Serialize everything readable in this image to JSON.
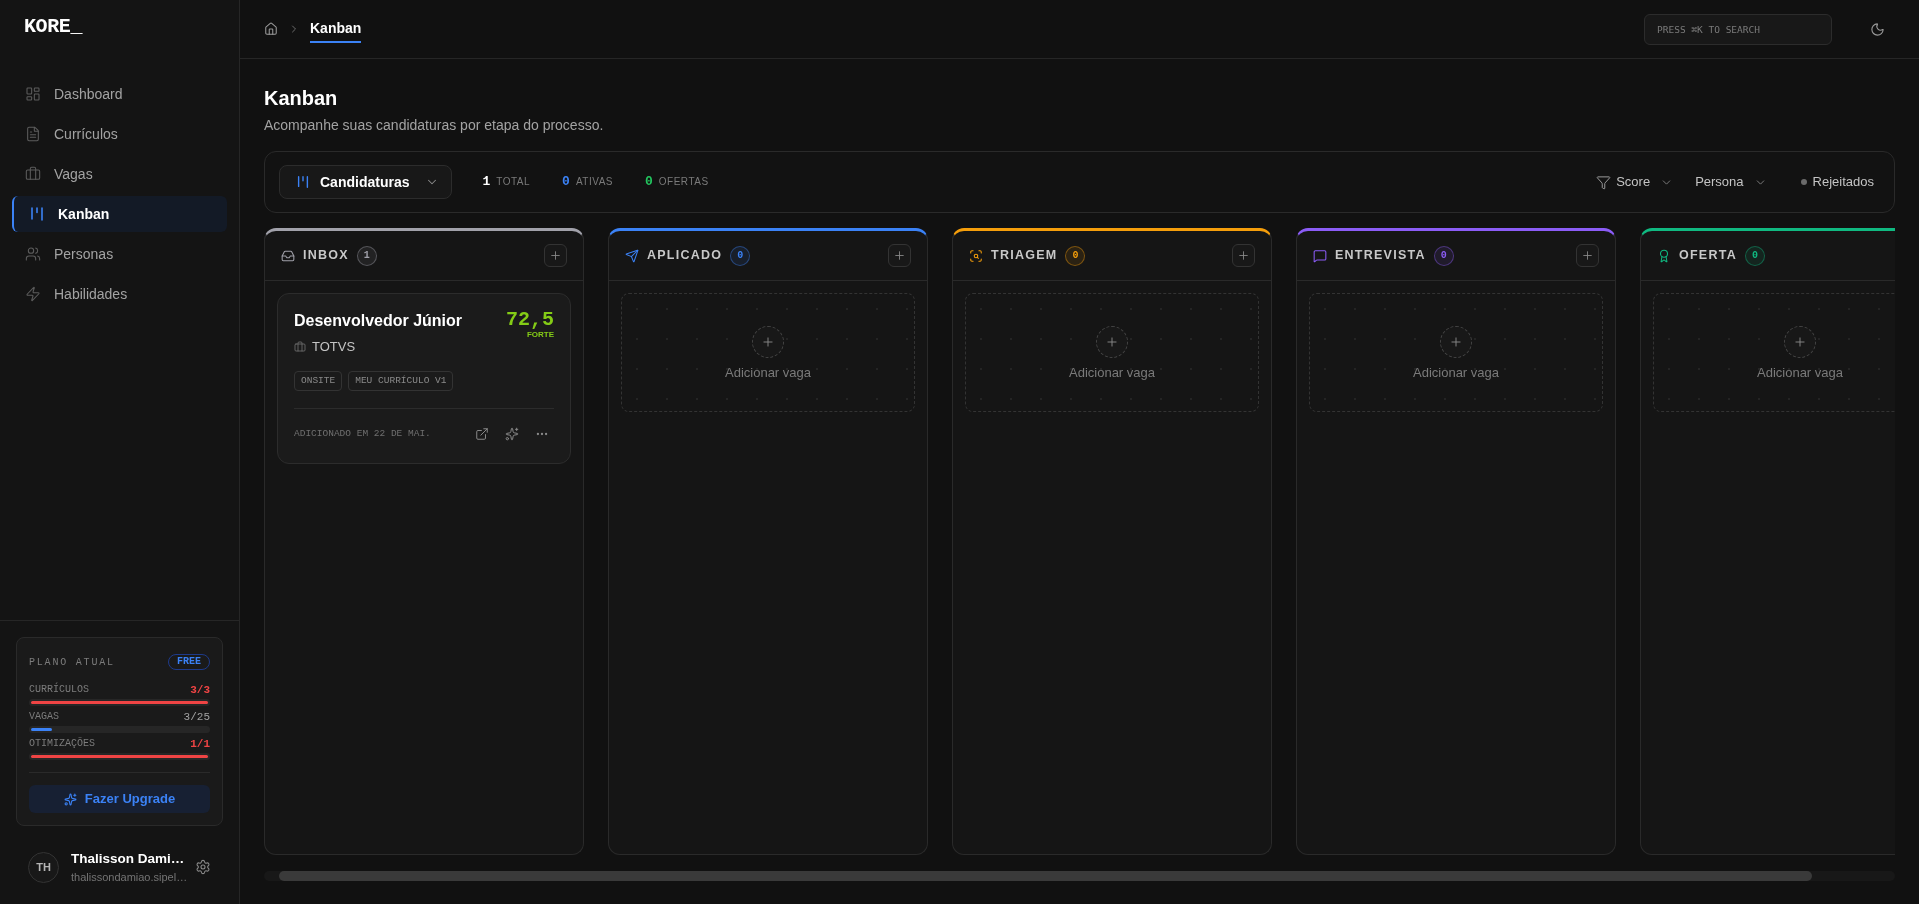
{
  "sidebar": {
    "logo": "KORE_",
    "nav": [
      {
        "label": "Dashboard",
        "selected": false
      },
      {
        "label": "Currículos",
        "selected": false
      },
      {
        "label": "Vagas",
        "selected": false
      },
      {
        "label": "Kanban",
        "selected": true
      },
      {
        "label": "Personas",
        "selected": false
      },
      {
        "label": "Habilidades",
        "selected": false
      }
    ],
    "plan": {
      "title": "PLANO ATUAL",
      "badge": "FREE",
      "usage": [
        {
          "label": "CURRÍCULOS",
          "value": "3/3",
          "level": 1,
          "at_limit": true
        },
        {
          "label": "VAGAS",
          "value": "3/25",
          "level": 0.12,
          "at_limit": false
        },
        {
          "label": "OTIMIZAÇÕES",
          "value": "1/1",
          "level": 1,
          "at_limit": true
        }
      ],
      "upgrade_button": "Fazer Upgrade"
    },
    "user": {
      "initials": "TH",
      "name": "Thalisson Dami…",
      "email": "thalissondamiao.sipel…"
    }
  },
  "topbar": {
    "breadcrumb": {
      "current": "Kanban"
    },
    "search": {
      "placeholder": "PRESS ⌘K TO SEARCH"
    }
  },
  "page": {
    "title": "Kanban",
    "subtitle": "Acompanhe suas candidaturas por etapa do processo."
  },
  "toolbar": {
    "view_selector": "Candidaturas",
    "stats": [
      {
        "value": "1",
        "label": "TOTAL",
        "color": "#ffffff"
      },
      {
        "value": "0",
        "label": "ATIVAS",
        "color": "#3b82f6"
      },
      {
        "value": "0",
        "label": "OFERTAS",
        "color": "#22c55e"
      }
    ],
    "filters": [
      "Score",
      "Persona"
    ],
    "rejected_toggle": {
      "label": "Rejeitados",
      "on": false
    }
  },
  "board": {
    "columns": [
      {
        "title": "INBOX",
        "count": "1",
        "color": "#a1a1aa",
        "cards": [
          {
            "title": "Desenvolvedor Júnior",
            "score": "72,5",
            "score_label": "FORTE",
            "company": "TOTVS",
            "tags": [
              "ONSITE",
              "MEU CURRÍCULO V1"
            ],
            "added": "ADICIONADO EM 22 DE MAI."
          }
        ]
      },
      {
        "title": "APLICADO",
        "count": "0",
        "color": "#3b82f6",
        "add_label": "Adicionar vaga"
      },
      {
        "title": "TRIAGEM",
        "count": "0",
        "color": "#f59e0b",
        "add_label": "Adicionar vaga"
      },
      {
        "title": "ENTREVISTA",
        "count": "0",
        "color": "#8b5cf6",
        "add_label": "Adicionar vaga"
      },
      {
        "title": "OFERTA",
        "count": "0",
        "color": "#10b981",
        "add_label": "Adicionar vaga"
      }
    ]
  }
}
